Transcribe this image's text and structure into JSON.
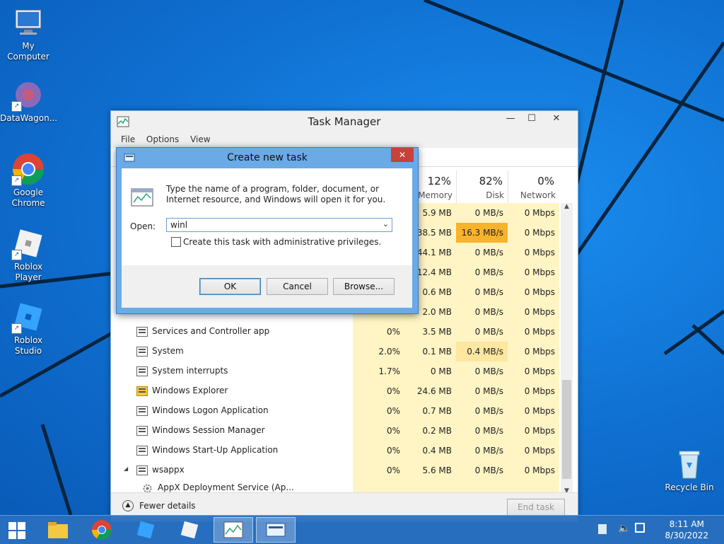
{
  "desktop_icons": [
    {
      "label": "My Computer",
      "icon": "computer-icon"
    },
    {
      "label": "DataWagon...",
      "icon": "datawagon-icon"
    },
    {
      "label": "Google Chrome",
      "icon": "chrome-icon"
    },
    {
      "label": "Roblox Player",
      "icon": "roblox-player-icon"
    },
    {
      "label": "Roblox Studio",
      "icon": "roblox-studio-icon"
    },
    {
      "label": "Recycle Bin",
      "icon": "recycle-bin-icon"
    }
  ],
  "task_manager": {
    "title": "Task Manager",
    "menu": [
      "File",
      "Options",
      "View"
    ],
    "columns": [
      {
        "pct": "12%",
        "label": "Memory"
      },
      {
        "pct": "82%",
        "label": "Disk"
      },
      {
        "pct": "0%",
        "label": "Network"
      }
    ],
    "rows": [
      {
        "name": "",
        "cpu": "",
        "mem": "5.9 MB",
        "disk": "0 MB/s",
        "net": "0 Mbps"
      },
      {
        "name": "",
        "cpu": "",
        "mem": "38.5 MB",
        "disk": "16.3 MB/s",
        "net": "0 Mbps"
      },
      {
        "name": "",
        "cpu": "",
        "mem": "44.1 MB",
        "disk": "0 MB/s",
        "net": "0 Mbps"
      },
      {
        "name": "",
        "cpu": "",
        "mem": "12.4 MB",
        "disk": "0 MB/s",
        "net": "0 Mbps"
      },
      {
        "name": "",
        "cpu": "",
        "mem": "0.6 MB",
        "disk": "0 MB/s",
        "net": "0 Mbps"
      },
      {
        "name": "",
        "cpu": "",
        "mem": "2.0 MB",
        "disk": "0 MB/s",
        "net": "0 Mbps"
      },
      {
        "name": "Services and Controller app",
        "cpu": "0%",
        "mem": "3.5 MB",
        "disk": "0 MB/s",
        "net": "0 Mbps"
      },
      {
        "name": "System",
        "cpu": "2.0%",
        "mem": "0.1 MB",
        "disk": "0.4 MB/s",
        "net": "0 Mbps"
      },
      {
        "name": "System interrupts",
        "cpu": "1.7%",
        "mem": "0 MB",
        "disk": "0 MB/s",
        "net": "0 Mbps"
      },
      {
        "name": "Windows Explorer",
        "cpu": "0%",
        "mem": "24.6 MB",
        "disk": "0 MB/s",
        "net": "0 Mbps"
      },
      {
        "name": "Windows Logon Application",
        "cpu": "0%",
        "mem": "0.7 MB",
        "disk": "0 MB/s",
        "net": "0 Mbps"
      },
      {
        "name": "Windows Session Manager",
        "cpu": "0%",
        "mem": "0.2 MB",
        "disk": "0 MB/s",
        "net": "0 Mbps"
      },
      {
        "name": "Windows Start-Up Application",
        "cpu": "0%",
        "mem": "0.4 MB",
        "disk": "0 MB/s",
        "net": "0 Mbps"
      },
      {
        "name": "wsappx",
        "cpu": "0%",
        "mem": "5.6 MB",
        "disk": "0 MB/s",
        "net": "0 Mbps"
      }
    ],
    "child_row": "AppX Deployment Service (Ap...",
    "fewer_details": "Fewer details",
    "end_task": "End task",
    "highlight_color": "#f7b32b",
    "mild_highlight_color": "#ffe7a0"
  },
  "dialog": {
    "title": "Create new task",
    "description": "Type the name of a program, folder, document, or Internet resource, and Windows will open it for you.",
    "open_label": "Open:",
    "open_value": "winl",
    "admin_checkbox_label": "Create this task with administrative privileges.",
    "ok": "OK",
    "cancel": "Cancel",
    "browse": "Browse..."
  },
  "taskbar": {
    "time": "8:11 AM",
    "date": "8/30/2022"
  }
}
